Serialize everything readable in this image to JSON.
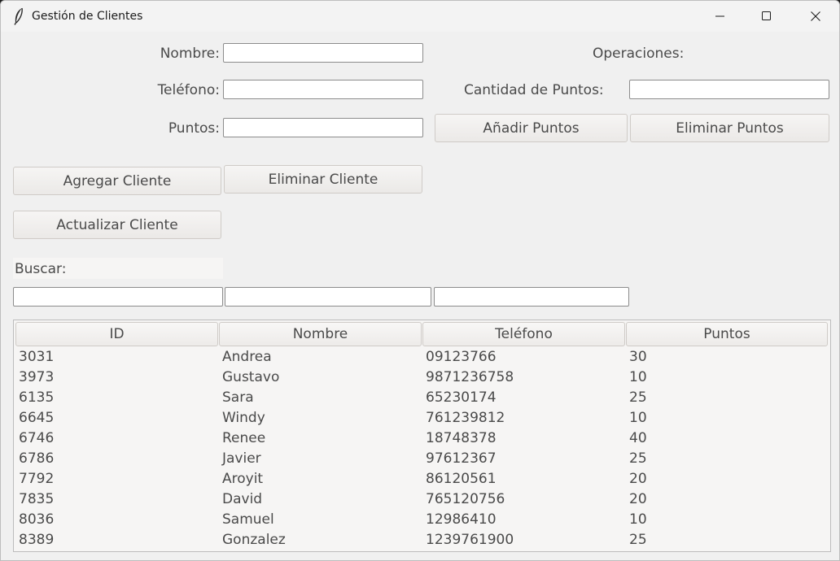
{
  "window": {
    "title": "Gestión de Clientes",
    "icon": "feather-icon",
    "controls": [
      "minimize-icon",
      "maximize-icon",
      "close-icon"
    ]
  },
  "form": {
    "nombre_label": "Nombre:",
    "nombre_value": "",
    "telefono_label": "Teléfono:",
    "telefono_value": "",
    "puntos_label": "Puntos:",
    "puntos_value": ""
  },
  "operaciones": {
    "title": "Operaciones:",
    "cantidad_label": "Cantidad de Puntos:",
    "cantidad_value": "",
    "add_points_button": "Añadir Puntos",
    "remove_points_button": "Eliminar Puntos"
  },
  "actions": {
    "add_client_button": "Agregar Cliente",
    "delete_client_button": "Eliminar Cliente",
    "update_client_button": "Actualizar Cliente"
  },
  "search": {
    "label": "Buscar:",
    "field1": "",
    "field2": "",
    "field3": ""
  },
  "table": {
    "columns": [
      "ID",
      "Nombre",
      "Teléfono",
      "Puntos"
    ],
    "rows": [
      [
        "3031",
        "Andrea",
        "09123766",
        "30"
      ],
      [
        "3973",
        "Gustavo",
        "9871236758",
        "10"
      ],
      [
        "6135",
        "Sara",
        "65230174",
        "25"
      ],
      [
        "6645",
        "Windy",
        "761239812",
        "10"
      ],
      [
        "6746",
        "Renee",
        "18748378",
        "40"
      ],
      [
        "6786",
        "Javier",
        "97612367",
        "25"
      ],
      [
        "7792",
        "Aroyit",
        "86120561",
        "20"
      ],
      [
        "7835",
        "David",
        "765120756",
        "20"
      ],
      [
        "8036",
        "Samuel",
        "12986410",
        "10"
      ],
      [
        "8389",
        "Gonzalez",
        "1239761900",
        "25"
      ]
    ]
  }
}
